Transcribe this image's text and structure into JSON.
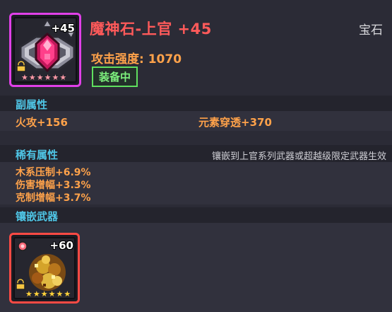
{
  "item": {
    "name": "魔神石-上官 +45",
    "level_tag": "+45",
    "type": "宝石",
    "attack_label": "攻击强度: 1070",
    "equipped": "装备中",
    "stars": [
      "★",
      "★",
      "★",
      "★",
      "★",
      "★"
    ],
    "frame_color": "#e040e8"
  },
  "secondary": {
    "title": "副属性",
    "stats": [
      "火攻+156",
      "元素穿透+370"
    ]
  },
  "rare": {
    "title": "稀有属性",
    "note": "镶嵌到上官系列武器或超越级限定武器生效",
    "stats": [
      "木系压制+6.9%",
      "伤害增幅+3.3%",
      "克制增幅+3.7%"
    ]
  },
  "inlay": {
    "title": "镶嵌武器",
    "level_tag": "+60",
    "stars": [
      "★",
      "★",
      "★",
      "★",
      "★",
      "★"
    ],
    "frame_color": "#ff4a44"
  }
}
